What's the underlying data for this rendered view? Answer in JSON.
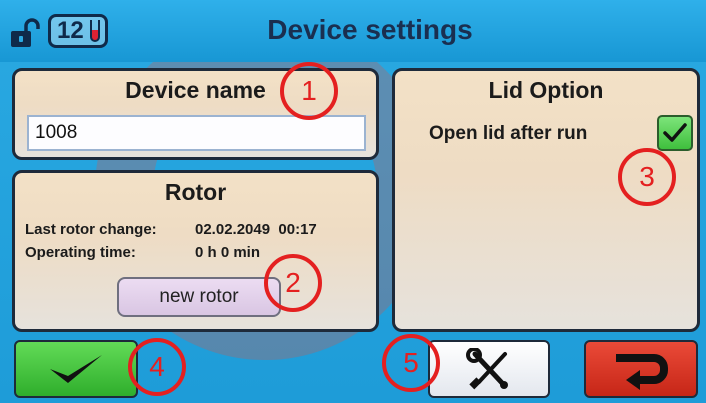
{
  "header": {
    "title": "Device settings",
    "badge_count": "12"
  },
  "device_name_panel": {
    "title": "Device name",
    "value": "1008"
  },
  "rotor_panel": {
    "title": "Rotor",
    "last_change_label": "Last rotor change:",
    "last_change_value": "02.02.2049  00:17",
    "operating_time_label": "Operating time:",
    "operating_time_value": "0 h 0 min",
    "new_rotor_label": "new rotor"
  },
  "lid_panel": {
    "title": "Lid Option",
    "option_label": "Open lid after run",
    "option_checked": true
  },
  "markers": [
    "1",
    "2",
    "3",
    "4",
    "5"
  ],
  "icons": {
    "lock": "unlocked-lock-icon",
    "tube": "test-tube-icon",
    "ok": "checkmark-icon",
    "tools": "wrench-screwdriver-icon",
    "back": "return-arrow-icon",
    "check": "checkmark-icon"
  },
  "colors": {
    "background": "#1ea2dd",
    "ok_button": "#3fbf3d",
    "back_button": "#d5301f",
    "marker": "#e42020"
  }
}
